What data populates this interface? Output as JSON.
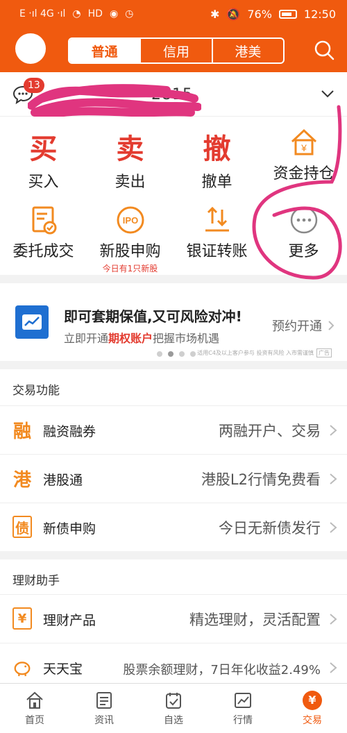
{
  "status_bar": {
    "left": "E ‧ıl 4G ‧ıl",
    "battery": "76%",
    "time": "12:50"
  },
  "header": {
    "avatar_emoji": "🐭",
    "tabs": [
      "普通",
      "信用",
      "港美"
    ],
    "active_tab": 0
  },
  "account": {
    "badge_count": "13",
    "text": "2815"
  },
  "actions": [
    {
      "label": "买入",
      "glyph": "买",
      "color": "red"
    },
    {
      "label": "卖出",
      "glyph": "卖",
      "color": "red"
    },
    {
      "label": "撤单",
      "glyph": "撤",
      "color": "red"
    },
    {
      "label": "资金持仓",
      "glyph": "",
      "color": "orange"
    },
    {
      "label": "委托成交",
      "glyph": "",
      "color": "orange"
    },
    {
      "label": "新股申购",
      "glyph": "IPO",
      "color": "orange",
      "sub": "今日有1只新股"
    },
    {
      "label": "银证转账",
      "glyph": "",
      "color": "orange"
    },
    {
      "label": "更多",
      "glyph": "",
      "color": "gray"
    }
  ],
  "banner": {
    "title": "即可套期保值,又可风险对冲!",
    "sub_prefix": "立即开通",
    "sub_highlight": "期权账户",
    "sub_suffix": "把握市场机遇",
    "cta": "预约开通",
    "disclaimer": "适用C4及以上客户参与 投资有风险 入市需谨慎",
    "ad": "广告"
  },
  "trade_section": {
    "title": "交易功能",
    "rows": [
      {
        "icon": "融",
        "label": "融资融券",
        "right": "两融开户、交易"
      },
      {
        "icon": "港",
        "label": "港股通",
        "right": "港股L2行情免费看"
      },
      {
        "icon": "债",
        "label": "新债申购",
        "right": "今日无新债发行"
      }
    ]
  },
  "finance_section": {
    "title": "理财助手",
    "rows": [
      {
        "icon": "¥",
        "label": "理财产品",
        "right": "精选理财，灵活配置"
      },
      {
        "icon": "宝",
        "label": "天天宝",
        "right": "股票余额理财，7日年化收益2.49%"
      }
    ]
  },
  "bottom_nav": [
    {
      "label": "首页",
      "icon": "home-icon"
    },
    {
      "label": "资讯",
      "icon": "news-icon"
    },
    {
      "label": "自选",
      "icon": "watchlist-icon"
    },
    {
      "label": "行情",
      "icon": "market-icon"
    },
    {
      "label": "交易",
      "icon": "trade-icon",
      "glyph": "¥"
    }
  ],
  "colors": {
    "brand": "#f05a0f",
    "accent_orange": "#f28a20",
    "accent_red": "#e33b2f"
  }
}
